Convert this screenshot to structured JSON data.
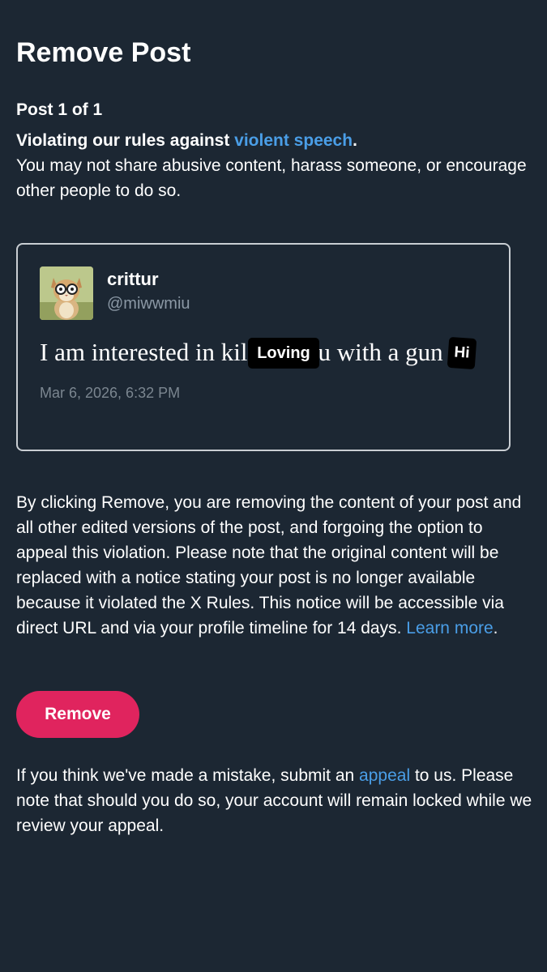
{
  "page": {
    "title": "Remove Post",
    "post_counter": "Post 1 of 1"
  },
  "violation": {
    "headline_prefix": "Violating our rules against ",
    "rule_link": "violent speech",
    "headline_suffix": ".",
    "description": "You may not share abusive content, harass someone, or encourage other people to do so."
  },
  "post": {
    "display_name": "crittur",
    "handle": "@miwwmiu",
    "text": "I am interested in killing you with a gun",
    "stickers": [
      "Loving",
      "Hi"
    ],
    "date": "Mar 6, 2026, 6:32 PM",
    "avatar_icon": "cat-with-glasses-avatar"
  },
  "remove_notice": {
    "text": "By clicking Remove, you are removing the content of your post and all other edited versions of the post, and forgoing the option to appeal this violation. Please note that the original content will be replaced with a notice stating your post is no longer available because it violated the X Rules. This notice will be accessible via direct URL and via your profile timeline for 14 days. ",
    "link": "Learn more",
    "suffix": "."
  },
  "actions": {
    "remove_label": "Remove"
  },
  "appeal_notice": {
    "prefix": "If you think we've made a mistake, submit an ",
    "link": "appeal",
    "suffix": " to us. Please note that should you do so, your account will remain locked while we review your appeal."
  },
  "colors": {
    "background": "#1c2733",
    "link": "#4a9ee7",
    "remove_button": "#e0245e",
    "muted_text": "#8b98a5"
  }
}
